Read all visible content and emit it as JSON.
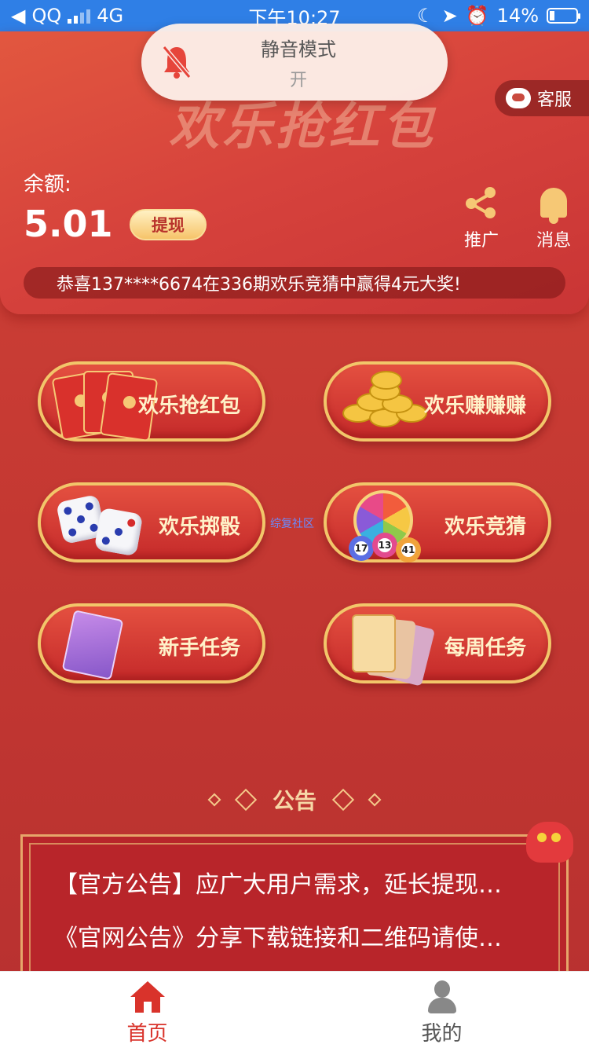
{
  "status_bar": {
    "back_app": "QQ",
    "network": "4G",
    "time": "下午10:27",
    "battery": "14%"
  },
  "toast": {
    "title": "静音模式",
    "state": "开"
  },
  "header": {
    "banner_title": "欢乐抢红包",
    "service_label": "客服",
    "balance_label": "余额:",
    "balance_value": "5.01",
    "withdraw_label": "提现",
    "quick_actions": [
      {
        "label": "推广",
        "icon": "share-icon"
      },
      {
        "label": "消息",
        "icon": "bell-icon"
      }
    ],
    "marquee_text": "恭喜137****6674在336期欢乐竞猜中赢得4元大奖!"
  },
  "games": [
    {
      "label": "欢乐抢红包",
      "icon": "red-envelope-icon"
    },
    {
      "label": "欢乐赚赚赚",
      "icon": "gold-coins-icon"
    },
    {
      "label": "欢乐掷骰",
      "icon": "dice-icon"
    },
    {
      "label": "欢乐竞猜",
      "icon": "lottery-wheel-icon"
    },
    {
      "label": "新手任务",
      "icon": "ticket-icon"
    },
    {
      "label": "每周任务",
      "icon": "cards-icon"
    }
  ],
  "lottery_balls": [
    "17",
    "13",
    "41"
  ],
  "watermark": "综复社区",
  "notice": {
    "title": "公告",
    "items": [
      "【官方公告】应广大用户需求，延长提现…",
      "《官网公告》分享下载链接和二维码请使…"
    ]
  },
  "tabbar": {
    "tabs": [
      {
        "label": "首页",
        "active": true,
        "color": "#d9332b"
      },
      {
        "label": "我的",
        "active": false,
        "color": "#555555"
      }
    ]
  },
  "colors": {
    "status_bar": "#2f7fe6",
    "accent_gold": "#f2c66a",
    "primary_red": "#c52a2a"
  }
}
